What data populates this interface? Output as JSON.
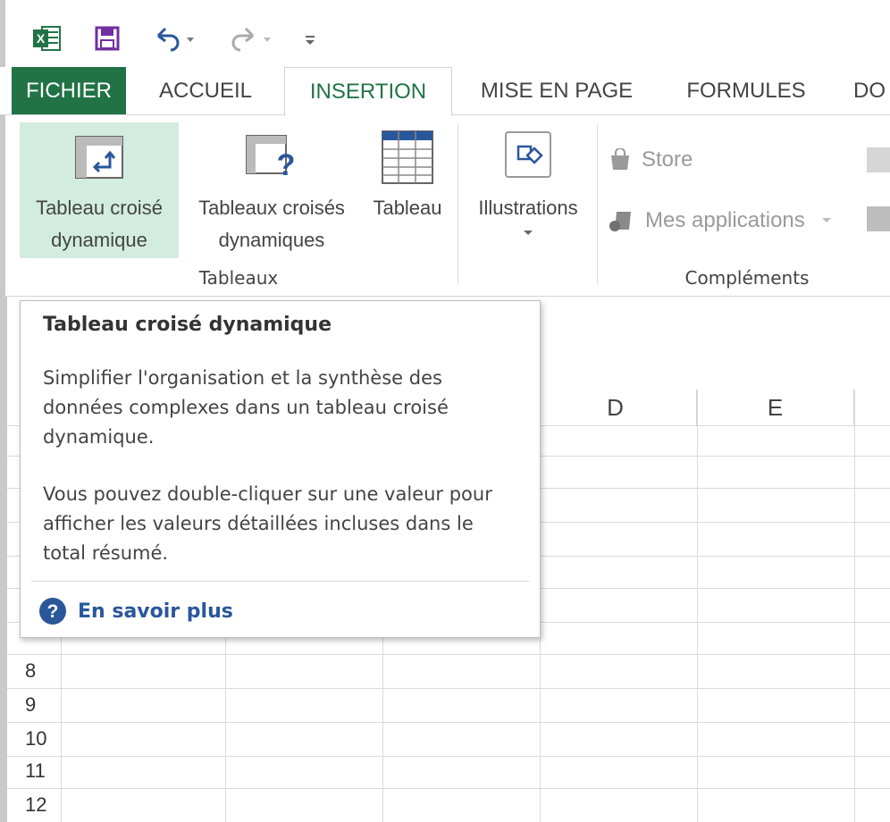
{
  "colors": {
    "brand": "#217346",
    "highlight": "#d3ece0",
    "link": "#2a579a"
  },
  "qat": {
    "icons": [
      "excel-icon",
      "save-icon",
      "undo-icon",
      "redo-icon",
      "customize-icon"
    ]
  },
  "tabs": [
    {
      "label": "FICHIER"
    },
    {
      "label": "ACCUEIL"
    },
    {
      "label": "INSERTION"
    },
    {
      "label": "MISE EN PAGE"
    },
    {
      "label": "FORMULES"
    },
    {
      "label": "DO"
    }
  ],
  "ribbon": {
    "pivot_line1": "Tableau croisé",
    "pivot_line2": "dynamique",
    "recommended_line1": "Tableaux croisés",
    "recommended_line2": "dynamiques",
    "table_label": "Tableau",
    "group_tableaux": "Tableaux",
    "illustrations_label": "Illustrations",
    "store_label": "Store",
    "apps_label": "Mes applications",
    "group_complements": "Compléments"
  },
  "sheet": {
    "columns": [
      "D",
      "E"
    ],
    "rows": [
      "8",
      "9",
      "10",
      "11",
      "12"
    ]
  },
  "tooltip": {
    "title": "Tableau croisé dynamique",
    "para1": "Simplifier l'organisation et la synthèse des données complexes dans un tableau croisé dynamique.",
    "para2": "Vous pouvez double-cliquer sur une valeur pour afficher les valeurs détaillées incluses dans le total résumé.",
    "link": "En savoir plus"
  }
}
